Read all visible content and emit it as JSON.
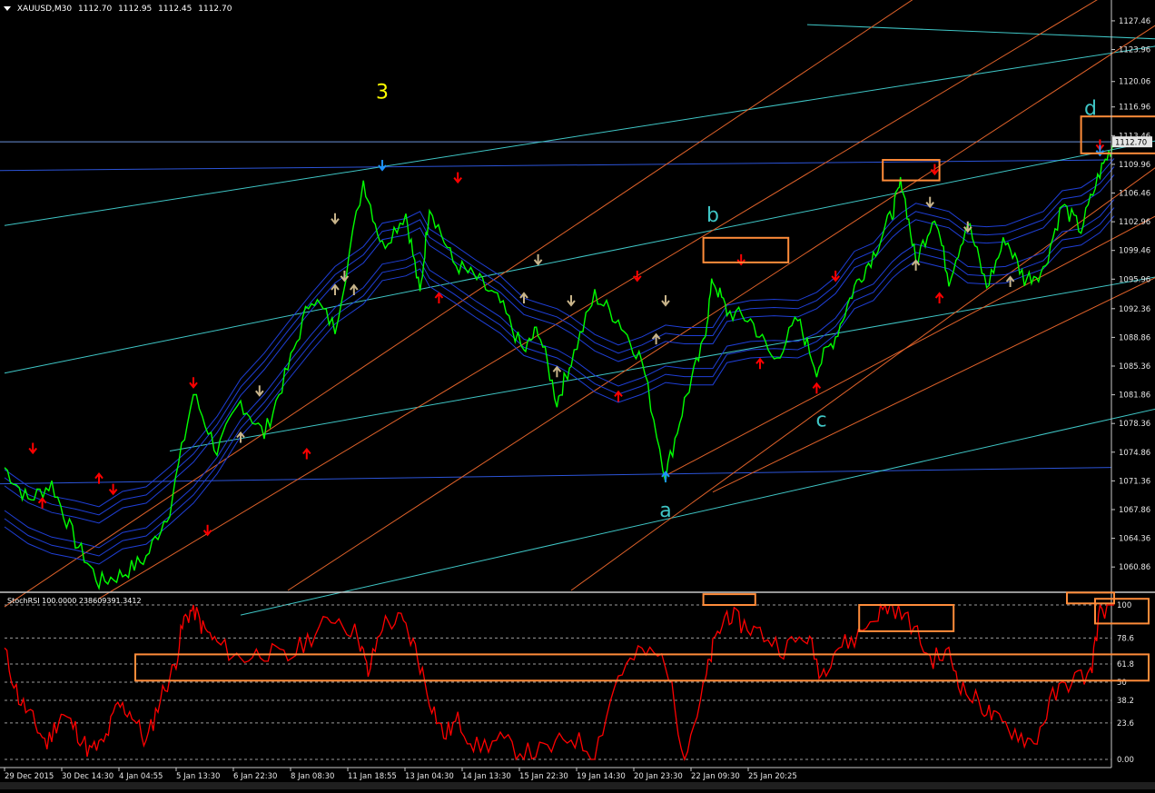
{
  "symbol_info": {
    "symbol": "XAUUSD,M30",
    "open": "1112.70",
    "high": "1112.95",
    "low": "1112.45",
    "close": "1112.70"
  },
  "wave_labels": {
    "w3": "3",
    "wb": "b",
    "wa": "a",
    "wc": "c",
    "wd": "d"
  },
  "current_price_label": "1112.70",
  "colors": {
    "background": "#000000",
    "candles": "#00ff00",
    "stoch_line": "#ff0000",
    "highlight_box": "#ff8c3a",
    "up_arrow": "#ff0000",
    "down_arrow": "#ff0000",
    "fractal_arrow": "#c8b48a",
    "pivot_arrow": "#1e90ff",
    "band": "#1f3fd6",
    "channel_cyan": "#3fc6c6",
    "channel_orange": "#e0622a",
    "wave_3": "#ffff00",
    "wave_abcd": "#3fc6c6"
  },
  "stoch_rsi": {
    "label": "StochRSI 100.0000 238609391.3412",
    "levels": [
      "100",
      "78.6",
      "61.8",
      "50",
      "38.2",
      "23.6",
      "0.00"
    ],
    "level_values": [
      100,
      78.6,
      61.8,
      50,
      38.2,
      23.6,
      0
    ]
  },
  "chart_data": [
    {
      "type": "line",
      "x_ticks": [
        "29 Dec 2015",
        "30 Dec 14:30",
        "4 Jan 04:55",
        "5 Jan 13:30",
        "6 Jan 22:30",
        "8 Jan 08:30",
        "11 Jan 18:55",
        "13 Jan 04:30",
        "14 Jan 13:30",
        "15 Jan 22:30",
        "19 Jan 14:30",
        "20 Jan 23:30",
        "22 Jan 09:30",
        "25 Jan 20:25"
      ],
      "y_ticks": [
        1127.46,
        1123.96,
        1120.06,
        1116.96,
        1113.46,
        1109.96,
        1106.46,
        1102.96,
        1099.46,
        1095.96,
        1092.36,
        1088.86,
        1085.36,
        1081.86,
        1078.36,
        1074.86,
        1071.36,
        1067.86,
        1064.36,
        1060.86
      ],
      "ylim": [
        1058,
        1130
      ],
      "series": [
        {
          "points": [
            [
              0,
              1073
            ],
            [
              0.5,
              1069
            ],
            [
              1.0,
              1071
            ],
            [
              1.5,
              1064
            ],
            [
              2.0,
              1059
            ],
            [
              2.5,
              1060
            ],
            [
              3.0,
              1062
            ],
            [
              3.5,
              1068
            ],
            [
              4.0,
              1082
            ],
            [
              4.5,
              1075
            ],
            [
              5.0,
              1081
            ],
            [
              5.5,
              1077
            ],
            [
              6.0,
              1085
            ],
            [
              6.5,
              1094
            ],
            [
              7.0,
              1090
            ],
            [
              7.6,
              1108
            ],
            [
              8.0,
              1100
            ],
            [
              8.5,
              1104
            ],
            [
              8.8,
              1094
            ],
            [
              9.0,
              1105
            ],
            [
              9.5,
              1098
            ],
            [
              10.0,
              1096
            ],
            [
              10.5,
              1093
            ],
            [
              11.0,
              1087
            ],
            [
              11.3,
              1090
            ],
            [
              11.7,
              1081
            ],
            [
              12.0,
              1086
            ],
            [
              12.5,
              1094
            ],
            [
              13.0,
              1091
            ],
            [
              13.5,
              1086
            ],
            [
              14.0,
              1072
            ],
            [
              14.4,
              1081
            ],
            [
              14.8,
              1088
            ],
            [
              15.0,
              1096
            ],
            [
              15.3,
              1092
            ],
            [
              15.8,
              1091
            ],
            [
              16.3,
              1086
            ],
            [
              16.8,
              1091
            ],
            [
              17.2,
              1085
            ],
            [
              17.6,
              1089
            ],
            [
              18.0,
              1095
            ],
            [
              18.4,
              1099
            ],
            [
              18.8,
              1104
            ],
            [
              19.0,
              1108
            ],
            [
              19.3,
              1098
            ],
            [
              19.7,
              1104
            ],
            [
              20.0,
              1096
            ],
            [
              20.4,
              1103
            ],
            [
              20.8,
              1095
            ],
            [
              21.2,
              1101
            ],
            [
              21.6,
              1096
            ],
            [
              22.0,
              1097
            ],
            [
              22.4,
              1105
            ],
            [
              22.8,
              1102
            ],
            [
              23.2,
              1109
            ],
            [
              23.5,
              1112.7
            ]
          ]
        }
      ],
      "wave_points": [
        {
          "label": "3",
          "x": 8.0,
          "y": 1118
        },
        {
          "label": "b",
          "x": 15.0,
          "y": 1103
        },
        {
          "label": "a",
          "x": 14.0,
          "y": 1067
        },
        {
          "label": "c",
          "x": 17.3,
          "y": 1078
        },
        {
          "label": "d",
          "x": 23.0,
          "y": 1116
        }
      ],
      "up_arrows": [
        [
          0.8,
          1068
        ],
        [
          2.0,
          1071
        ],
        [
          6.4,
          1074
        ],
        [
          9.2,
          1093
        ],
        [
          13.0,
          1081
        ],
        [
          16.0,
          1085
        ],
        [
          17.2,
          1082
        ],
        [
          19.8,
          1093
        ]
      ],
      "down_arrows": [
        [
          0.6,
          1076
        ],
        [
          2.3,
          1071
        ],
        [
          4.0,
          1084
        ],
        [
          4.3,
          1066
        ],
        [
          9.6,
          1109
        ],
        [
          13.4,
          1097
        ],
        [
          15.6,
          1099
        ],
        [
          17.6,
          1097
        ],
        [
          19.7,
          1110
        ],
        [
          23.2,
          1113
        ]
      ],
      "fractal_up": [
        [
          5.0,
          1076
        ],
        [
          7.0,
          1094
        ],
        [
          7.4,
          1094
        ],
        [
          11.0,
          1093
        ],
        [
          11.7,
          1084
        ],
        [
          13.8,
          1088
        ],
        [
          19.3,
          1097
        ],
        [
          21.3,
          1095
        ]
      ],
      "fractal_down": [
        [
          5.4,
          1083
        ],
        [
          7.0,
          1104
        ],
        [
          7.2,
          1097
        ],
        [
          11.3,
          1099
        ],
        [
          12.0,
          1094
        ],
        [
          14.0,
          1094
        ],
        [
          19.6,
          1106
        ],
        [
          20.4,
          1103
        ]
      ],
      "highlight_boxes": [
        {
          "x1": 14.8,
          "x2": 16.6,
          "y1": 1098,
          "y2": 1101
        },
        {
          "x1": 18.6,
          "x2": 19.8,
          "y1": 1108,
          "y2": 1110.5
        },
        {
          "x1": 22.8,
          "x2": 24.6,
          "y1": 1111.3,
          "y2": 1115.8
        }
      ]
    },
    {
      "type": "line",
      "ylim": [
        0,
        100
      ],
      "series": [
        {
          "points": [
            [
              0,
              70
            ],
            [
              0.3,
              40
            ],
            [
              0.6,
              25
            ],
            [
              0.9,
              10
            ],
            [
              1.2,
              30
            ],
            [
              1.5,
              20
            ],
            [
              1.8,
              5
            ],
            [
              2.1,
              10
            ],
            [
              2.4,
              35
            ],
            [
              2.7,
              30
            ],
            [
              3.0,
              10
            ],
            [
              3.3,
              40
            ],
            [
              3.6,
              60
            ],
            [
              3.8,
              90
            ],
            [
              4.0,
              98
            ],
            [
              4.2,
              85
            ],
            [
              4.5,
              75
            ],
            [
              5.0,
              65
            ],
            [
              5.5,
              70
            ],
            [
              6.0,
              65
            ],
            [
              6.5,
              80
            ],
            [
              7.0,
              93
            ],
            [
              7.5,
              80
            ],
            [
              7.7,
              55
            ],
            [
              8.0,
              88
            ],
            [
              8.4,
              90
            ],
            [
              8.7,
              72
            ],
            [
              9.0,
              40
            ],
            [
              9.3,
              15
            ],
            [
              9.6,
              25
            ],
            [
              10.0,
              8
            ],
            [
              10.5,
              12
            ],
            [
              11.0,
              4
            ],
            [
              11.5,
              6
            ],
            [
              12.0,
              15
            ],
            [
              12.5,
              4
            ],
            [
              13.0,
              55
            ],
            [
              13.5,
              70
            ],
            [
              14.0,
              65
            ],
            [
              14.4,
              2
            ],
            [
              14.8,
              45
            ],
            [
              15.0,
              72
            ],
            [
              15.3,
              95
            ],
            [
              15.6,
              88
            ],
            [
              16.0,
              82
            ],
            [
              16.5,
              72
            ],
            [
              17.0,
              80
            ],
            [
              17.3,
              55
            ],
            [
              17.6,
              72
            ],
            [
              18.0,
              78
            ],
            [
              18.5,
              95
            ],
            [
              18.8,
              100
            ],
            [
              19.2,
              88
            ],
            [
              19.6,
              65
            ],
            [
              20.0,
              68
            ],
            [
              20.3,
              45
            ],
            [
              20.7,
              35
            ],
            [
              21.0,
              25
            ],
            [
              21.4,
              18
            ],
            [
              21.8,
              10
            ],
            [
              22.2,
              40
            ],
            [
              22.6,
              52
            ],
            [
              23.0,
              55
            ],
            [
              23.2,
              97
            ],
            [
              23.5,
              100
            ]
          ]
        }
      ],
      "highlight_boxes": [
        {
          "x1": 14.8,
          "x2": 15.9,
          "y1": 100,
          "y2": 107
        },
        {
          "x1": 18.1,
          "x2": 20.1,
          "y1": 83,
          "y2": 100
        },
        {
          "x1": 22.5,
          "x2": 23.5,
          "y1": 101,
          "y2": 108
        },
        {
          "x1": 4.1,
          "x2": 34.8,
          "y1": 51,
          "y2": 68
        },
        {
          "x1": 33.1,
          "x2": 34.7,
          "y1": 88,
          "y2": 104
        }
      ]
    }
  ]
}
